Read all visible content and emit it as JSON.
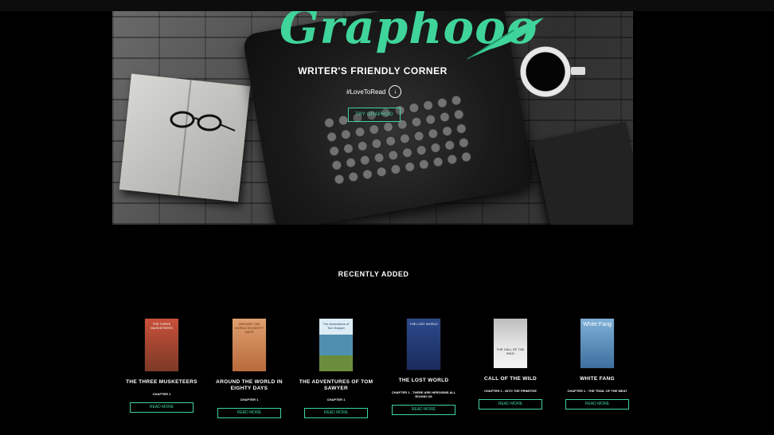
{
  "hero": {
    "brand": "Graphooo",
    "headline": "WRITER'S FRIENDLY CORNER",
    "hashtag": "#LoveToRead",
    "cta_label": "TRY GRAPHOO"
  },
  "recent": {
    "title": "RECENTLY ADDED",
    "read_more_label": "READ MORE",
    "books": [
      {
        "title": "THE THREE MUSKETEERS",
        "chapter": "CHAPTER 1",
        "cover_text": "THE THREE MUSKETEERS",
        "cover_color": "#b2452a"
      },
      {
        "title": "AROUND THE WORLD IN EIGHTY DAYS",
        "chapter": "CHAPTER 1",
        "cover_text": "AROUND THE WORLD IN EIGHTY DAYS",
        "cover_color": "#d98a55"
      },
      {
        "title": "THE ADVENTURES OF TOM SAWYER",
        "chapter": "CHAPTER 1",
        "cover_text": "The Adventures of Tom Sawyer",
        "cover_color": "#4f8fb0"
      },
      {
        "title": "THE LOST WORLD",
        "chapter": "CHAPTER 1 - THERE ARE HEROISMS ALL ROUND US",
        "cover_text": "THE LOST WORLD",
        "cover_color": "#233d7a"
      },
      {
        "title": "CALL OF THE WILD",
        "chapter": "CHAPTER 1 - INTO THE PRIMITIVE",
        "cover_text": "THE CALL OF THE WILD",
        "cover_color": "#d8d8d8"
      },
      {
        "title": "WHITE FANG",
        "chapter": "CHAPTER 1 - THE TRAIL OF THE MEAT",
        "cover_text": "White Fang",
        "cover_color": "#4f86b8"
      }
    ]
  },
  "colors": {
    "accent": "#3fd49a",
    "background": "#000000"
  }
}
